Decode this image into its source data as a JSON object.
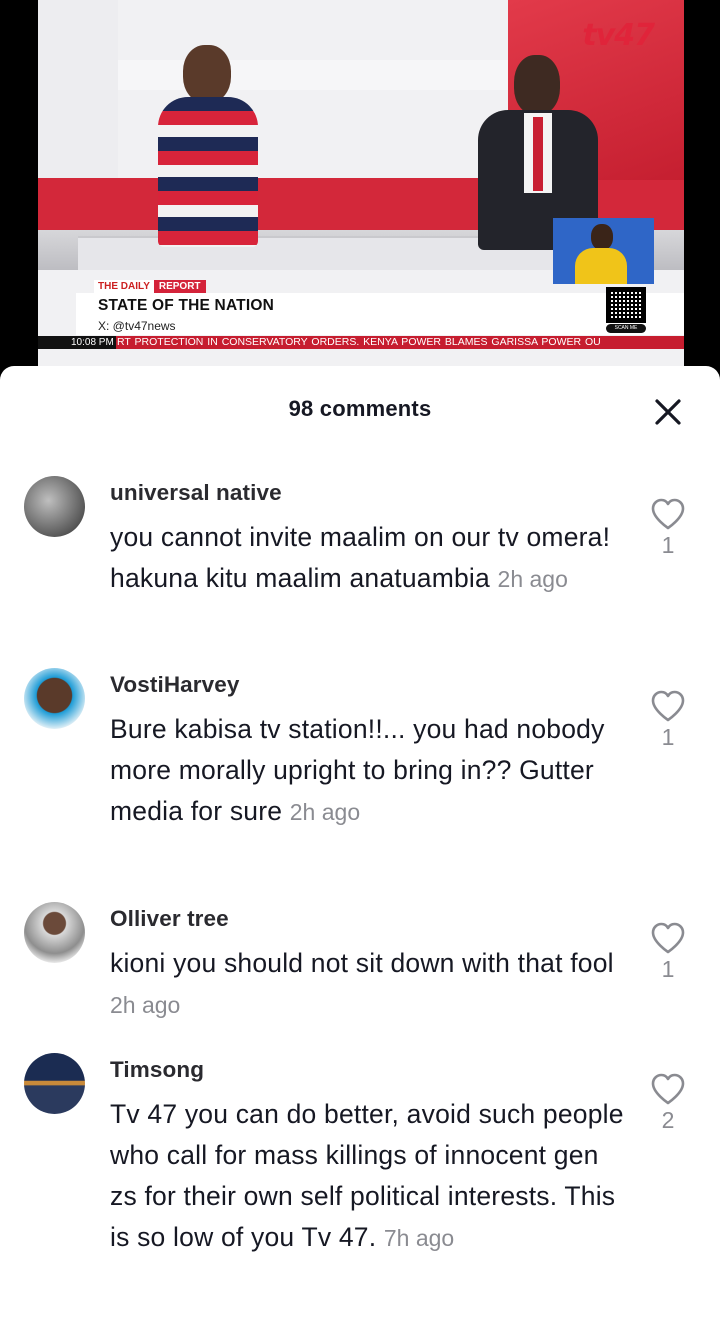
{
  "video": {
    "channel_logo": "tv47",
    "strap_label_left": "THE DAILY",
    "strap_label_right": "REPORT",
    "show_title": "STATE OF THE NATION",
    "social_handle": "X: @tv47news",
    "scan_label": "SCAN ME",
    "ticker_time": "10:08 PM",
    "ticker_text": "RT PROTECTION IN CONSERVATORY ORDERS.    KENYA POWER BLAMES GARISSA POWER OU"
  },
  "comments_panel": {
    "title": "98 comments",
    "close_icon": "close-icon",
    "comments": [
      {
        "username": "universal native",
        "text": "you cannot invite maalim on our tv omera! hakuna kitu maalim anatuambia",
        "time": "2h ago",
        "likes": "1"
      },
      {
        "username": "VostiHarvey",
        "text": "Bure kabisa tv station!!... you had nobody more morally upright to bring in?? Gutter media for sure",
        "time": "2h ago",
        "likes": "1"
      },
      {
        "username": "Olliver tree",
        "text": "kioni you should not sit down with that fool",
        "time": "2h ago",
        "likes": "1"
      },
      {
        "username": "Timsong",
        "text": "Tv 47 you can do better, avoid such people who call for mass killings of innocent gen zs for their own self political interests. This is so low of you Tv 47.",
        "time": "7h ago",
        "likes": "2"
      }
    ]
  },
  "colors": {
    "accent_red": "#d3283a",
    "text_primary": "#161823",
    "text_secondary": "#8a8b91"
  }
}
